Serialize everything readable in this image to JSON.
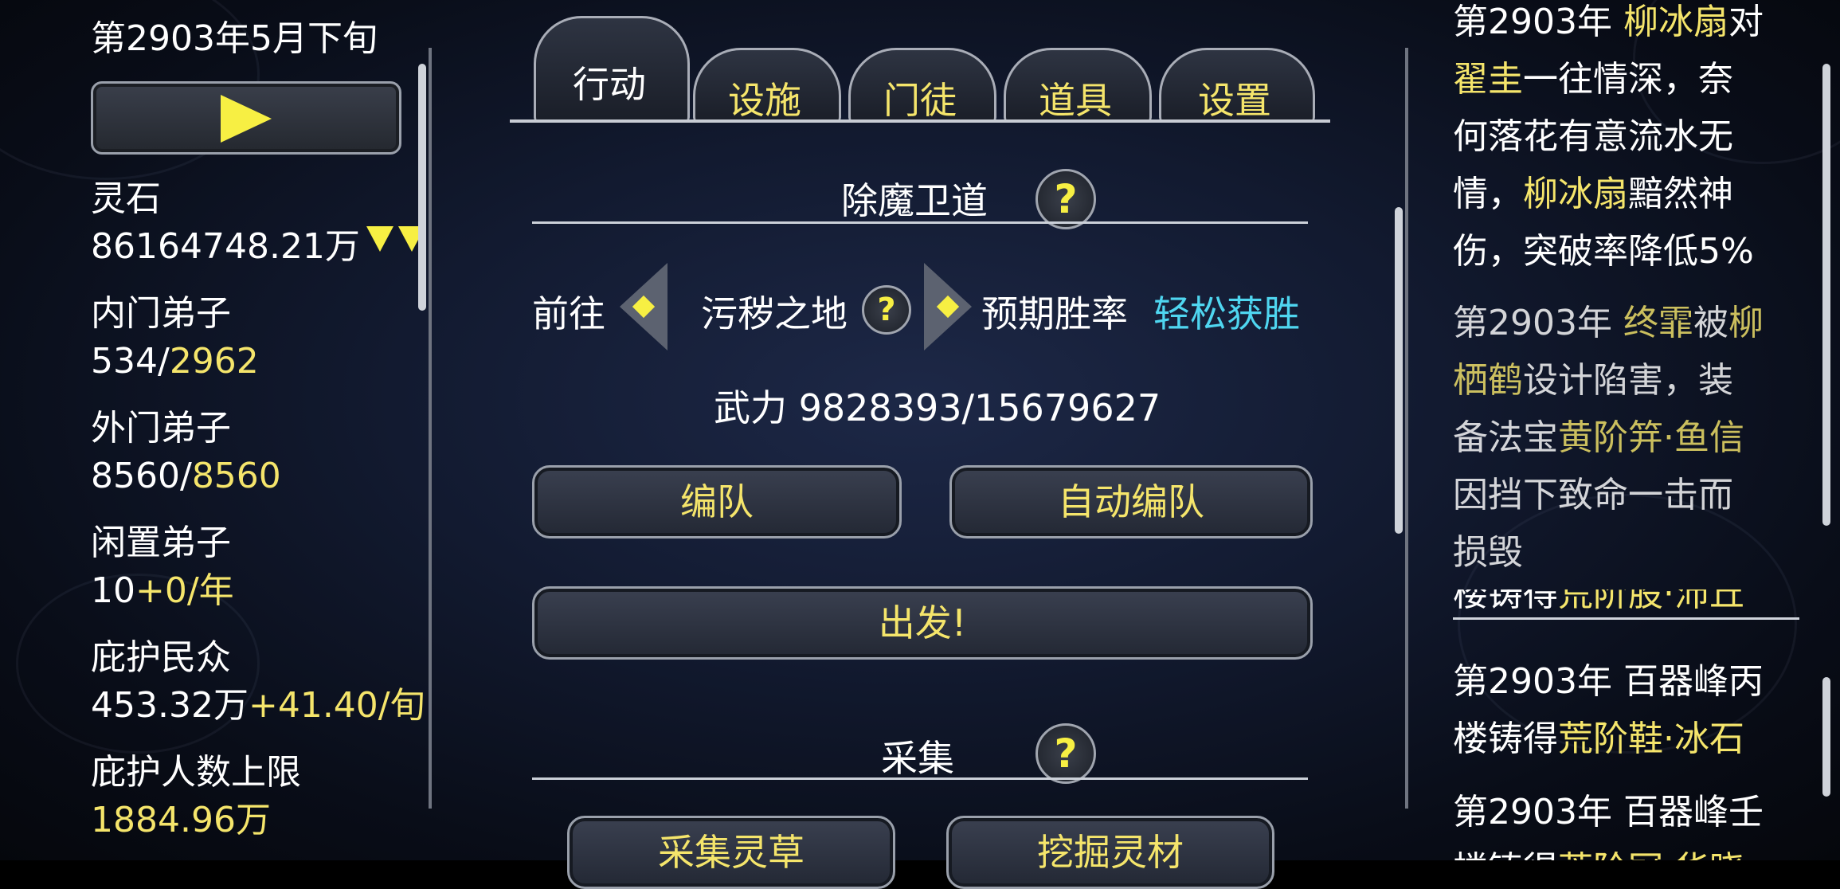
{
  "header": {
    "date": "第2903年5月下旬"
  },
  "left_panel": {
    "stats": [
      {
        "label": "灵石",
        "value_white": "86164748.21万",
        "value_yellow": ""
      },
      {
        "label": "内门弟子",
        "value_white": "534/",
        "value_yellow": "2962"
      },
      {
        "label": "外门弟子",
        "value_white": "8560/",
        "value_yellow": "8560"
      },
      {
        "label": "闲置弟子",
        "value_white": "10",
        "value_yellow": "+0/年"
      },
      {
        "label": "庇护民众",
        "value_white": "453.32万",
        "value_yellow": "+41.40/旬"
      },
      {
        "label": "庇护人数上限",
        "value_white": "",
        "value_yellow": "1884.96万"
      }
    ]
  },
  "tabs": [
    {
      "label": "行动",
      "active": true
    },
    {
      "label": "设施",
      "active": false
    },
    {
      "label": "门徒",
      "active": false
    },
    {
      "label": "道具",
      "active": false
    },
    {
      "label": "设置",
      "active": false
    }
  ],
  "mission": {
    "title": "除魔卫道",
    "goto_label": "前往",
    "location": "污秽之地",
    "win_rate_label": "预期胜率",
    "win_rate_value": "轻松获胜",
    "power_text": "武力 9828393/15679627",
    "btn_team": "编队",
    "btn_auto_team": "自动编队",
    "btn_depart": "出发!"
  },
  "gather": {
    "title": "采集",
    "btn_herb": "采集灵草",
    "btn_mine": "挖掘灵材"
  },
  "help_glyph": "?",
  "log": {
    "entry1": {
      "l1_w1": "第2903年 ",
      "l1_y1": "柳冰扇",
      "l1_w2": "对",
      "l2_y1": "翟圭",
      "l2_w1": "一往情深，奈",
      "l3_w1": "何落花有意流水无",
      "l4_w1": "情，",
      "l4_y1": "柳冰扇",
      "l4_w2": "黯然神",
      "l5_w1": "伤，突破率降低5%"
    },
    "entry2": {
      "l1_w1": "第2903年 ",
      "l1_y1": "终霏",
      "l1_w2": "被",
      "l1_y2": "柳",
      "l2_y1": "栖鹤",
      "l2_w1": "设计陷害，装",
      "l3_w1": "备法宝",
      "l3_y1": "黄阶笄·鱼信",
      "l4_w1": "因挡下致命一击而",
      "l5_w1": "损毁"
    },
    "entry3": {
      "l0_w1": "楼铸得",
      "l0_y1": "荒阶股·沛丘"
    },
    "entry4": {
      "l1_w1": "第2903年 百器峰丙",
      "l2_w1": "楼铸得",
      "l2_y1": "荒阶鞋·冰石"
    },
    "entry5": {
      "l1_w1": "第2903年 百器峰壬",
      "l2_w1": "楼铸得",
      "l2_y1": "荒阶冠·华晓"
    }
  },
  "colors": {
    "accent_yellow": "#f5e56b",
    "cyan": "#4fd6f0",
    "text": "#ffffff"
  }
}
